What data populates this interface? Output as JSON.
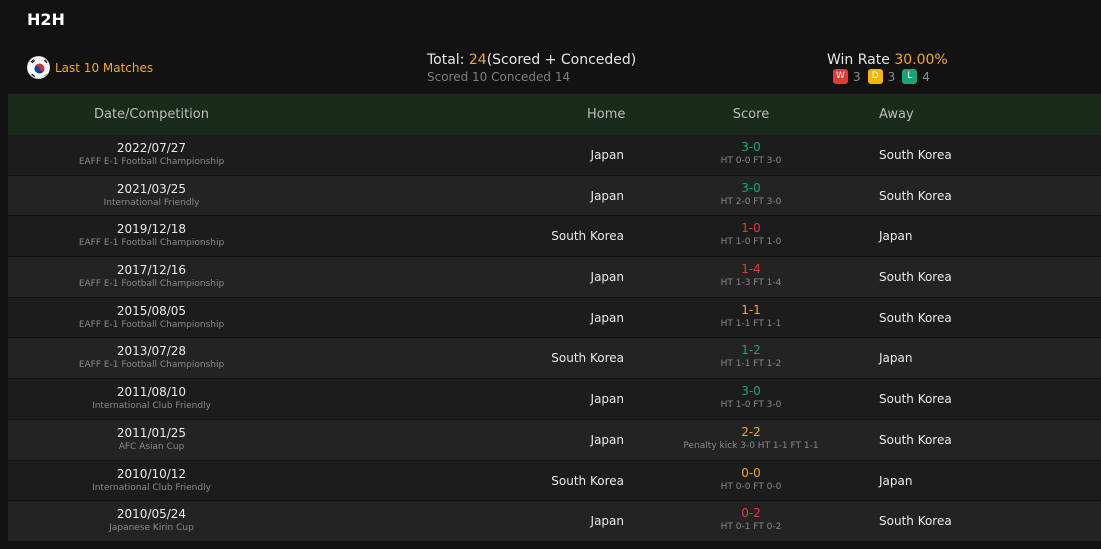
{
  "title": "H2H",
  "summary": {
    "flag_icon": "south-korea-flag-icon",
    "last_matches_label": "Last 10 Matches",
    "total_prefix": "Total: ",
    "total_value": "24",
    "total_suffix": "(Scored + Conceded)",
    "scored_conceded": "Scored 10 Conceded 14",
    "win_rate_label": "Win Rate ",
    "win_rate_value": "30.00%",
    "wins_badge": "W",
    "wins": "3",
    "draws_badge": "D",
    "draws": "3",
    "losses_badge": "L",
    "losses": "4"
  },
  "columns": {
    "date": "Date/Competition",
    "home": "Home",
    "score": "Score",
    "away": "Away"
  },
  "colors": {
    "win": "#17a673",
    "loss": "#e53935",
    "draw": "#f5a623",
    "accent": "#f5a623",
    "header_bg": "#1a2b1b"
  },
  "matches": [
    {
      "date": "2022/07/27",
      "competition": "EAFF E-1 Football Championship",
      "home": "Japan",
      "score": "3-0",
      "result": "win",
      "detail": "HT 0-0 FT 3-0",
      "away": "South Korea"
    },
    {
      "date": "2021/03/25",
      "competition": "International Friendly",
      "home": "Japan",
      "score": "3-0",
      "result": "win",
      "detail": "HT 2-0 FT 3-0",
      "away": "South Korea"
    },
    {
      "date": "2019/12/18",
      "competition": "EAFF E-1 Football Championship",
      "home": "South Korea",
      "score": "1-0",
      "result": "loss",
      "detail": "HT 1-0 FT 1-0",
      "away": "Japan"
    },
    {
      "date": "2017/12/16",
      "competition": "EAFF E-1 Football Championship",
      "home": "Japan",
      "score": "1-4",
      "result": "loss",
      "detail": "HT 1-3 FT 1-4",
      "away": "South Korea"
    },
    {
      "date": "2015/08/05",
      "competition": "EAFF E-1 Football Championship",
      "home": "Japan",
      "score": "1-1",
      "result": "draw",
      "detail": "HT 1-1 FT 1-1",
      "away": "South Korea"
    },
    {
      "date": "2013/07/28",
      "competition": "EAFF E-1 Football Championship",
      "home": "South Korea",
      "score": "1-2",
      "result": "win",
      "detail": "HT 1-1 FT 1-2",
      "away": "Japan"
    },
    {
      "date": "2011/08/10",
      "competition": "International Club Friendly",
      "home": "Japan",
      "score": "3-0",
      "result": "win",
      "detail": "HT 1-0 FT 3-0",
      "away": "South Korea"
    },
    {
      "date": "2011/01/25",
      "competition": "AFC Asian Cup",
      "home": "Japan",
      "score": "2-2",
      "result": "draw",
      "detail": "Penalty kick 3-0 HT 1-1 FT 1-1",
      "away": "South Korea"
    },
    {
      "date": "2010/10/12",
      "competition": "International Club Friendly",
      "home": "South Korea",
      "score": "0-0",
      "result": "draw",
      "detail": "HT 0-0 FT 0-0",
      "away": "Japan"
    },
    {
      "date": "2010/05/24",
      "competition": "Japanese Kirin Cup",
      "home": "Japan",
      "score": "0-2",
      "result": "loss",
      "detail": "HT 0-1 FT 0-2",
      "away": "South Korea"
    }
  ]
}
